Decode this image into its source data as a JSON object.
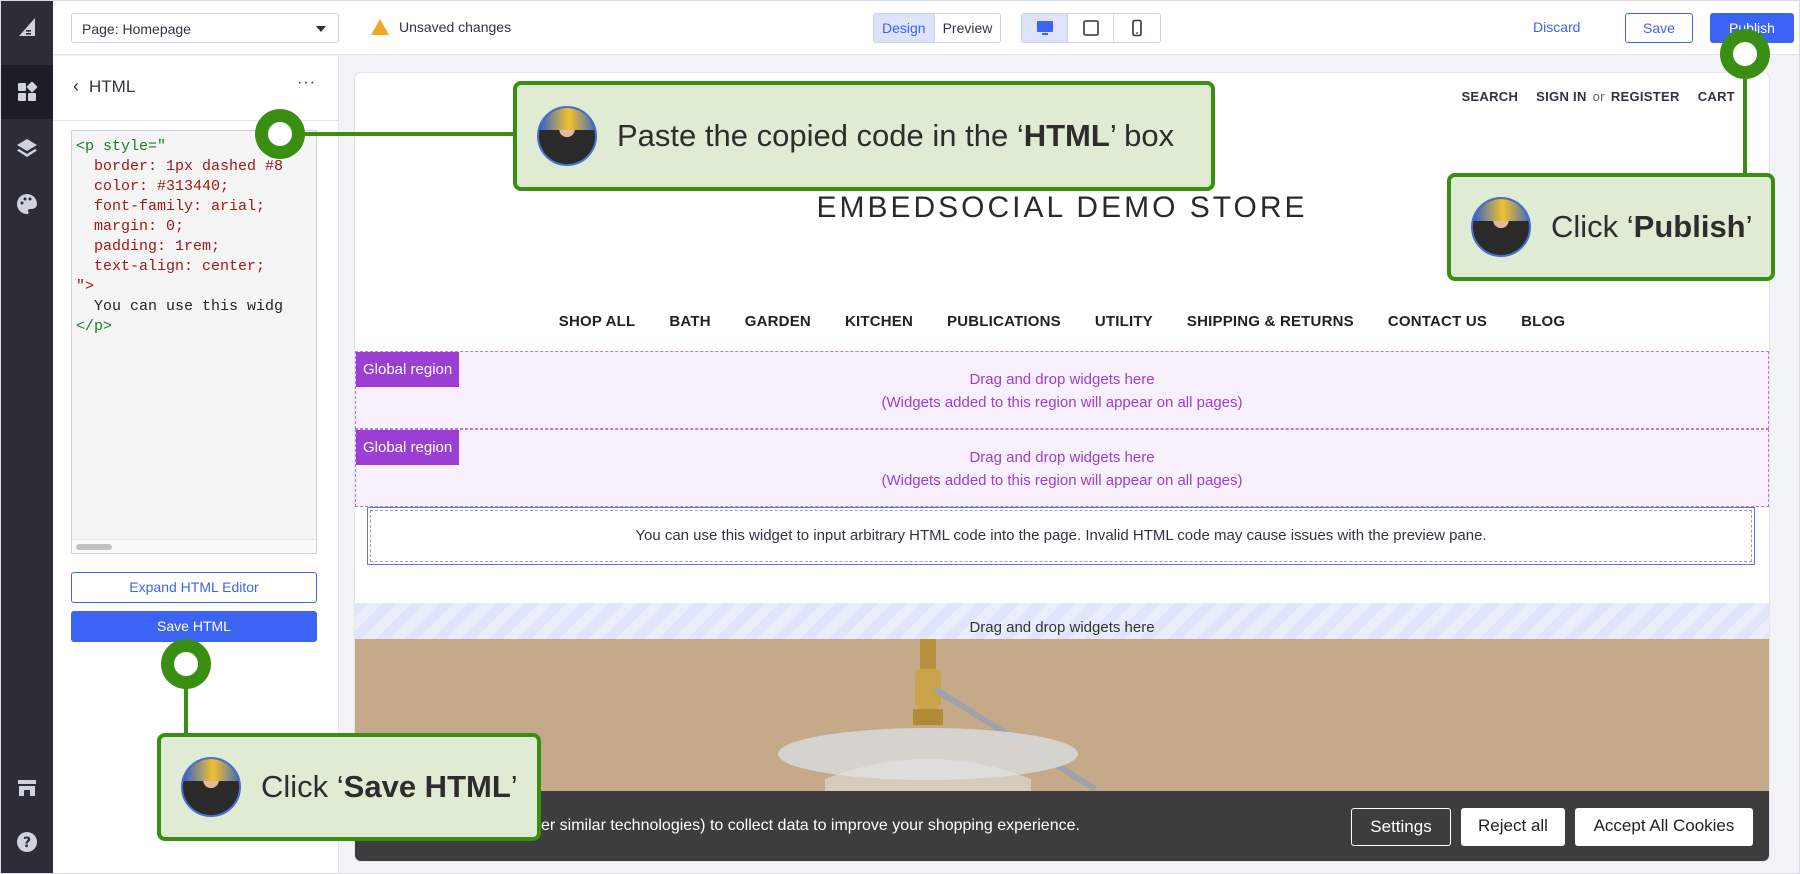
{
  "topbar": {
    "page_selector": "Page: Homepage",
    "unsaved": "Unsaved changes",
    "design_tab": "Design",
    "preview_tab": "Preview",
    "discard": "Discard",
    "save": "Save",
    "publish": "Publish"
  },
  "rail": {
    "icons": [
      "bigcommerce-logo-icon",
      "widgets-icon",
      "layers-icon",
      "theme-styles-icon",
      "storefront-icon",
      "help-icon"
    ]
  },
  "panel": {
    "title": "HTML",
    "more": "···",
    "code_lines": [
      "<p style=\"",
      "  border: 1px dashed #8",
      "  color: #313440;",
      "  font-family: arial;",
      "  margin: 0;",
      "  padding: 1rem;",
      "  text-align: center;",
      "\">",
      "  You can use this widg",
      "</p>"
    ],
    "expand_button": "Expand HTML Editor",
    "save_button": "Save HTML"
  },
  "store": {
    "search": "SEARCH",
    "sign_in": "SIGN IN",
    "or": "or",
    "register": "REGISTER",
    "cart": "CART",
    "title": "EMBEDSOCIAL DEMO STORE",
    "nav": [
      "SHOP ALL",
      "BATH",
      "GARDEN",
      "KITCHEN",
      "PUBLICATIONS",
      "UTILITY",
      "SHIPPING & RETURNS",
      "CONTACT US",
      "BLOG"
    ],
    "region_label": "Global region",
    "region_line1": "Drag and drop widgets here",
    "region_line2": "(Widgets added to this region will appear on all pages)",
    "html_widget_text": "You can use this widget to input arbitrary HTML code into the page. Invalid HTML code may cause issues with the preview pane.",
    "dropzone_text": "Drag and drop widgets here"
  },
  "cookie": {
    "text": "er similar technologies) to collect data to improve your shopping experience.",
    "settings": "Settings",
    "reject": "Reject all",
    "accept": "Accept All Cookies"
  },
  "callouts": {
    "paste_pre": "Paste the copied code in the ‘",
    "paste_bold": "HTML",
    "paste_post": "’ box",
    "publish_pre": "Click ‘",
    "publish_bold": "Publish",
    "publish_post": "’",
    "save_pre": "Click ‘",
    "save_bold": "Save HTML",
    "save_post": "’"
  },
  "colors": {
    "accent": "#3c64f4",
    "callout_green": "#3a8f13",
    "callout_bg": "#e0ebd3",
    "region_purple": "#9b3fd4",
    "rail_bg": "#2b2e37"
  }
}
